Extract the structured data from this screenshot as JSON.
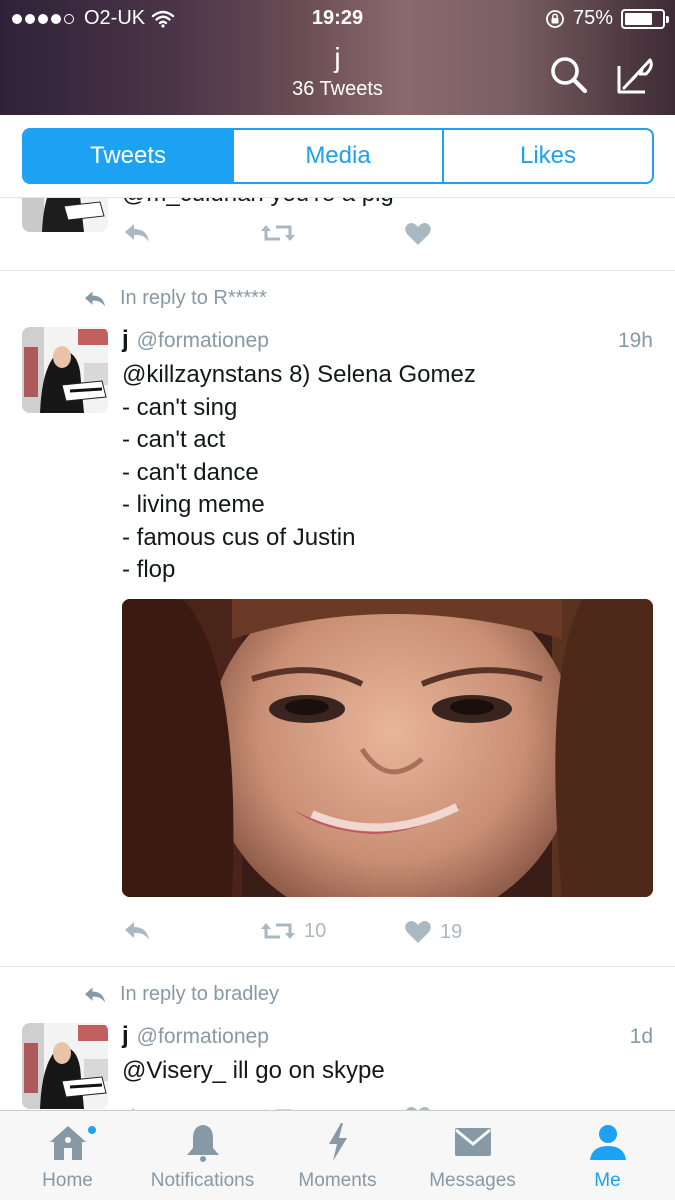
{
  "status_bar": {
    "carrier": "O2-UK",
    "time": "19:29",
    "battery_text": "75%",
    "battery_level": 0.75
  },
  "header": {
    "name": "j",
    "tweet_count": "36 Tweets"
  },
  "tabs": [
    {
      "label": "Tweets",
      "active": true
    },
    {
      "label": "Media",
      "active": false
    },
    {
      "label": "Likes",
      "active": false
    }
  ],
  "tweets": [
    {
      "partial_text": "@m_culunan you're a pig"
    },
    {
      "reply_to": "In reply to R*****",
      "name": "j",
      "handle": "@formationep",
      "time": "19h",
      "lines": [
        "@killzaynstans 8) Selena Gomez",
        "- can't sing",
        "- can't act",
        "- can't dance",
        "- living meme",
        "- famous cus of Justin",
        "- flop"
      ],
      "retweets": "10",
      "likes": "19"
    },
    {
      "reply_to": "In reply to bradley",
      "name": "j",
      "handle": "@formationep",
      "time": "1d",
      "lines": [
        "@Visery_ ill go on skype"
      ]
    }
  ],
  "tabbar": [
    {
      "label": "Home",
      "icon": "home-icon",
      "active": false,
      "badge": true
    },
    {
      "label": "Notifications",
      "icon": "bell-icon",
      "active": false
    },
    {
      "label": "Moments",
      "icon": "lightning-icon",
      "active": false
    },
    {
      "label": "Messages",
      "icon": "envelope-icon",
      "active": false
    },
    {
      "label": "Me",
      "icon": "person-icon",
      "active": true
    }
  ],
  "colors": {
    "accent": "#1da1f2",
    "muted": "#8899a6",
    "action_gray": "#aab8c2"
  }
}
